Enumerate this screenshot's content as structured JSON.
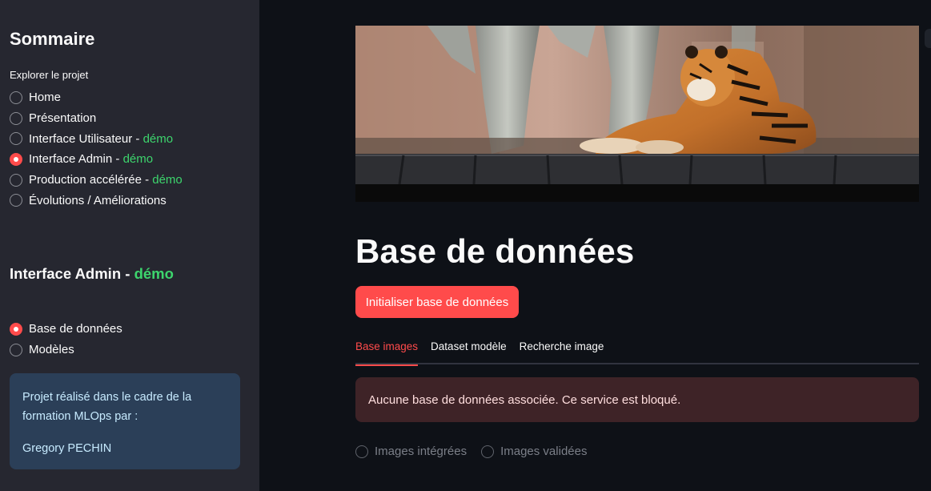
{
  "sidebar": {
    "title": "Sommaire",
    "explore_caption": "Explorer le projet",
    "nav_items": [
      {
        "label": "Home",
        "suffix": "",
        "selected": false
      },
      {
        "label": "Présentation",
        "suffix": "",
        "selected": false
      },
      {
        "label": "Interface Utilisateur - ",
        "suffix": "démo",
        "selected": false
      },
      {
        "label": "Interface Admin - ",
        "suffix": "démo",
        "selected": true
      },
      {
        "label": "Production accélérée - ",
        "suffix": "démo",
        "selected": false
      },
      {
        "label": "Évolutions / Améliorations",
        "suffix": "",
        "selected": false
      }
    ],
    "section_title": "Interface Admin - ",
    "section_title_suffix": "démo",
    "sub_items": [
      {
        "label": "Base de données",
        "selected": true
      },
      {
        "label": "Modèles",
        "selected": false
      }
    ],
    "info": {
      "line1": "Projet réalisé dans le cadre de la formation MLOps par :",
      "author": "Gregory PECHIN"
    }
  },
  "main": {
    "banner_subject": "tiger-photo",
    "title": "Base de données",
    "init_button": "Initialiser base de données",
    "tabs": [
      "Base images",
      "Dataset modèle",
      "Recherche image"
    ],
    "active_tab": 0,
    "alert": "Aucune base de données associée. Ce service est bloqué.",
    "radio_options": [
      "Images intégrées",
      "Images validées"
    ]
  },
  "colors": {
    "accent": "#ff4b4b",
    "demo_green": "#3dd56d",
    "background": "#0e1117",
    "sidebar": "#262730",
    "info_box": "#2b3f58",
    "alert_bg": "#3e2327"
  }
}
